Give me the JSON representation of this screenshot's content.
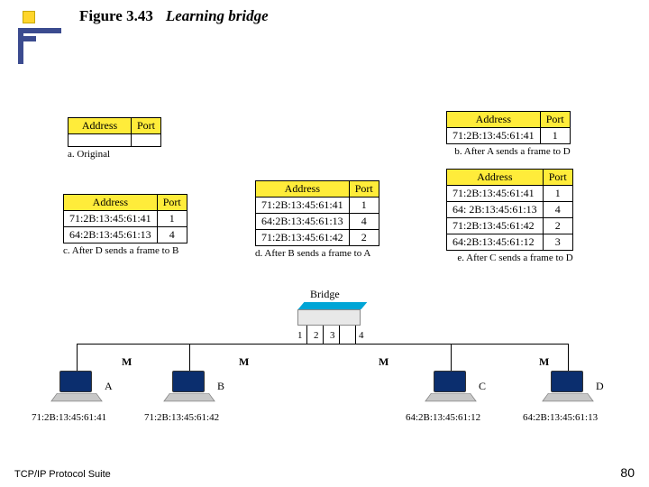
{
  "header": {
    "fignum": "Figure 3.43",
    "title": "Learning bridge"
  },
  "tables": {
    "a": {
      "cap": "a. Original",
      "head": [
        "Address",
        "Port"
      ],
      "rows": []
    },
    "b": {
      "cap": "b. After A sends a frame to D",
      "head": [
        "Address",
        "Port"
      ],
      "rows": [
        [
          "71:2B:13:45:61:41",
          "1"
        ]
      ]
    },
    "c": {
      "cap": "c. After D sends a frame to B",
      "head": [
        "Address",
        "Port"
      ],
      "rows": [
        [
          "71:2B:13:45:61:41",
          "1"
        ],
        [
          "64:2B:13:45:61:13",
          "4"
        ]
      ]
    },
    "d": {
      "cap": "d. After B sends a frame to A",
      "head": [
        "Address",
        "Port"
      ],
      "rows": [
        [
          "71:2B:13:45:61:41",
          "1"
        ],
        [
          "64:2B:13:45:61:13",
          "4"
        ],
        [
          "71:2B:13:45:61:42",
          "2"
        ]
      ]
    },
    "e": {
      "cap": "e. After C sends a frame to D",
      "head": [
        "Address",
        "Port"
      ],
      "rows": [
        [
          "71:2B:13:45:61:41",
          "1"
        ],
        [
          "64: 2B:13:45:61:13",
          "4"
        ],
        [
          "71:2B:13:45:61:42",
          "2"
        ],
        [
          "64:2B:13:45:61:12",
          "3"
        ]
      ]
    }
  },
  "bridge_label": "Bridge",
  "ports": [
    "1",
    "2",
    "3",
    "4"
  ],
  "hosts": {
    "A": {
      "label": "A",
      "mac": "71:2B:13:45:61:41"
    },
    "B": {
      "label": "B",
      "mac": "71:2B:13:45:61:42"
    },
    "C": {
      "label": "C",
      "mac": "64:2B:13:45:61:12"
    },
    "D": {
      "label": "D",
      "mac": "64:2B:13:45:61:13"
    }
  },
  "mbadges": [
    "M",
    "M",
    "M",
    "M"
  ],
  "footer": "TCP/IP Protocol Suite",
  "pagenum": "80"
}
